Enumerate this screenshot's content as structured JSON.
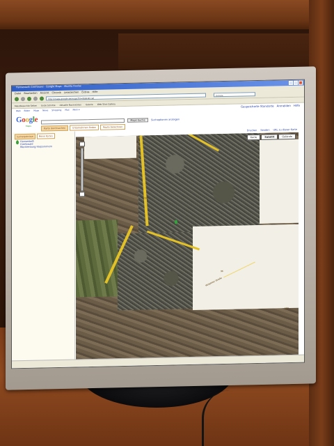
{
  "browser": {
    "window_title": "Hansestadt Greifswald - Google Maps - Mozilla Firefox",
    "menus": [
      "Datei",
      "Bearbeiten",
      "Ansicht",
      "Chronik",
      "Lesezeichen",
      "Extras",
      "Hilfe"
    ],
    "url": "http://maps.google.de/maps?hl=de&tab=wl",
    "search_placeholder": "Google",
    "bookmarks": [
      "Meistbesuchte Seiten",
      "Erste Schritte",
      "Aktuelle Nachrichten",
      "Galerie",
      "Web Slice Gallery"
    ]
  },
  "maps": {
    "gnav": [
      "Web",
      "Bilder",
      "Maps",
      "News",
      "Shopping",
      "Mail",
      "Mehr ▾"
    ],
    "top_links": [
      "Gespeicherte Standorte",
      "Anmelden",
      "Hilfe"
    ],
    "logo_letters": [
      "G",
      "o",
      "o",
      "g",
      "l",
      "e"
    ],
    "logo_sub": "Maps",
    "search_button": "Maps-Suche",
    "search_options": "Suchoptionen anzeigen",
    "tabs": [
      "Karte durchsuchen",
      "Unternehmen finden",
      "Route berechnen"
    ],
    "side_tabs": [
      "Suchergebnisse",
      "Meine Karten"
    ],
    "result_title": "Hansestadt",
    "result_lines": [
      "Greifswald",
      "Mecklenburg-Vorpommern"
    ],
    "map_links": [
      "Drucken",
      "Senden",
      "URL zu dieser Karte"
    ],
    "map_types": [
      "Karte",
      "Satellit",
      "Gelände"
    ],
    "active_map_type": "Satellit",
    "road_labels": [
      "109",
      "96",
      "109",
      "Wolgaster Straße"
    ]
  },
  "monitor": {
    "brand": "BelinEA"
  }
}
